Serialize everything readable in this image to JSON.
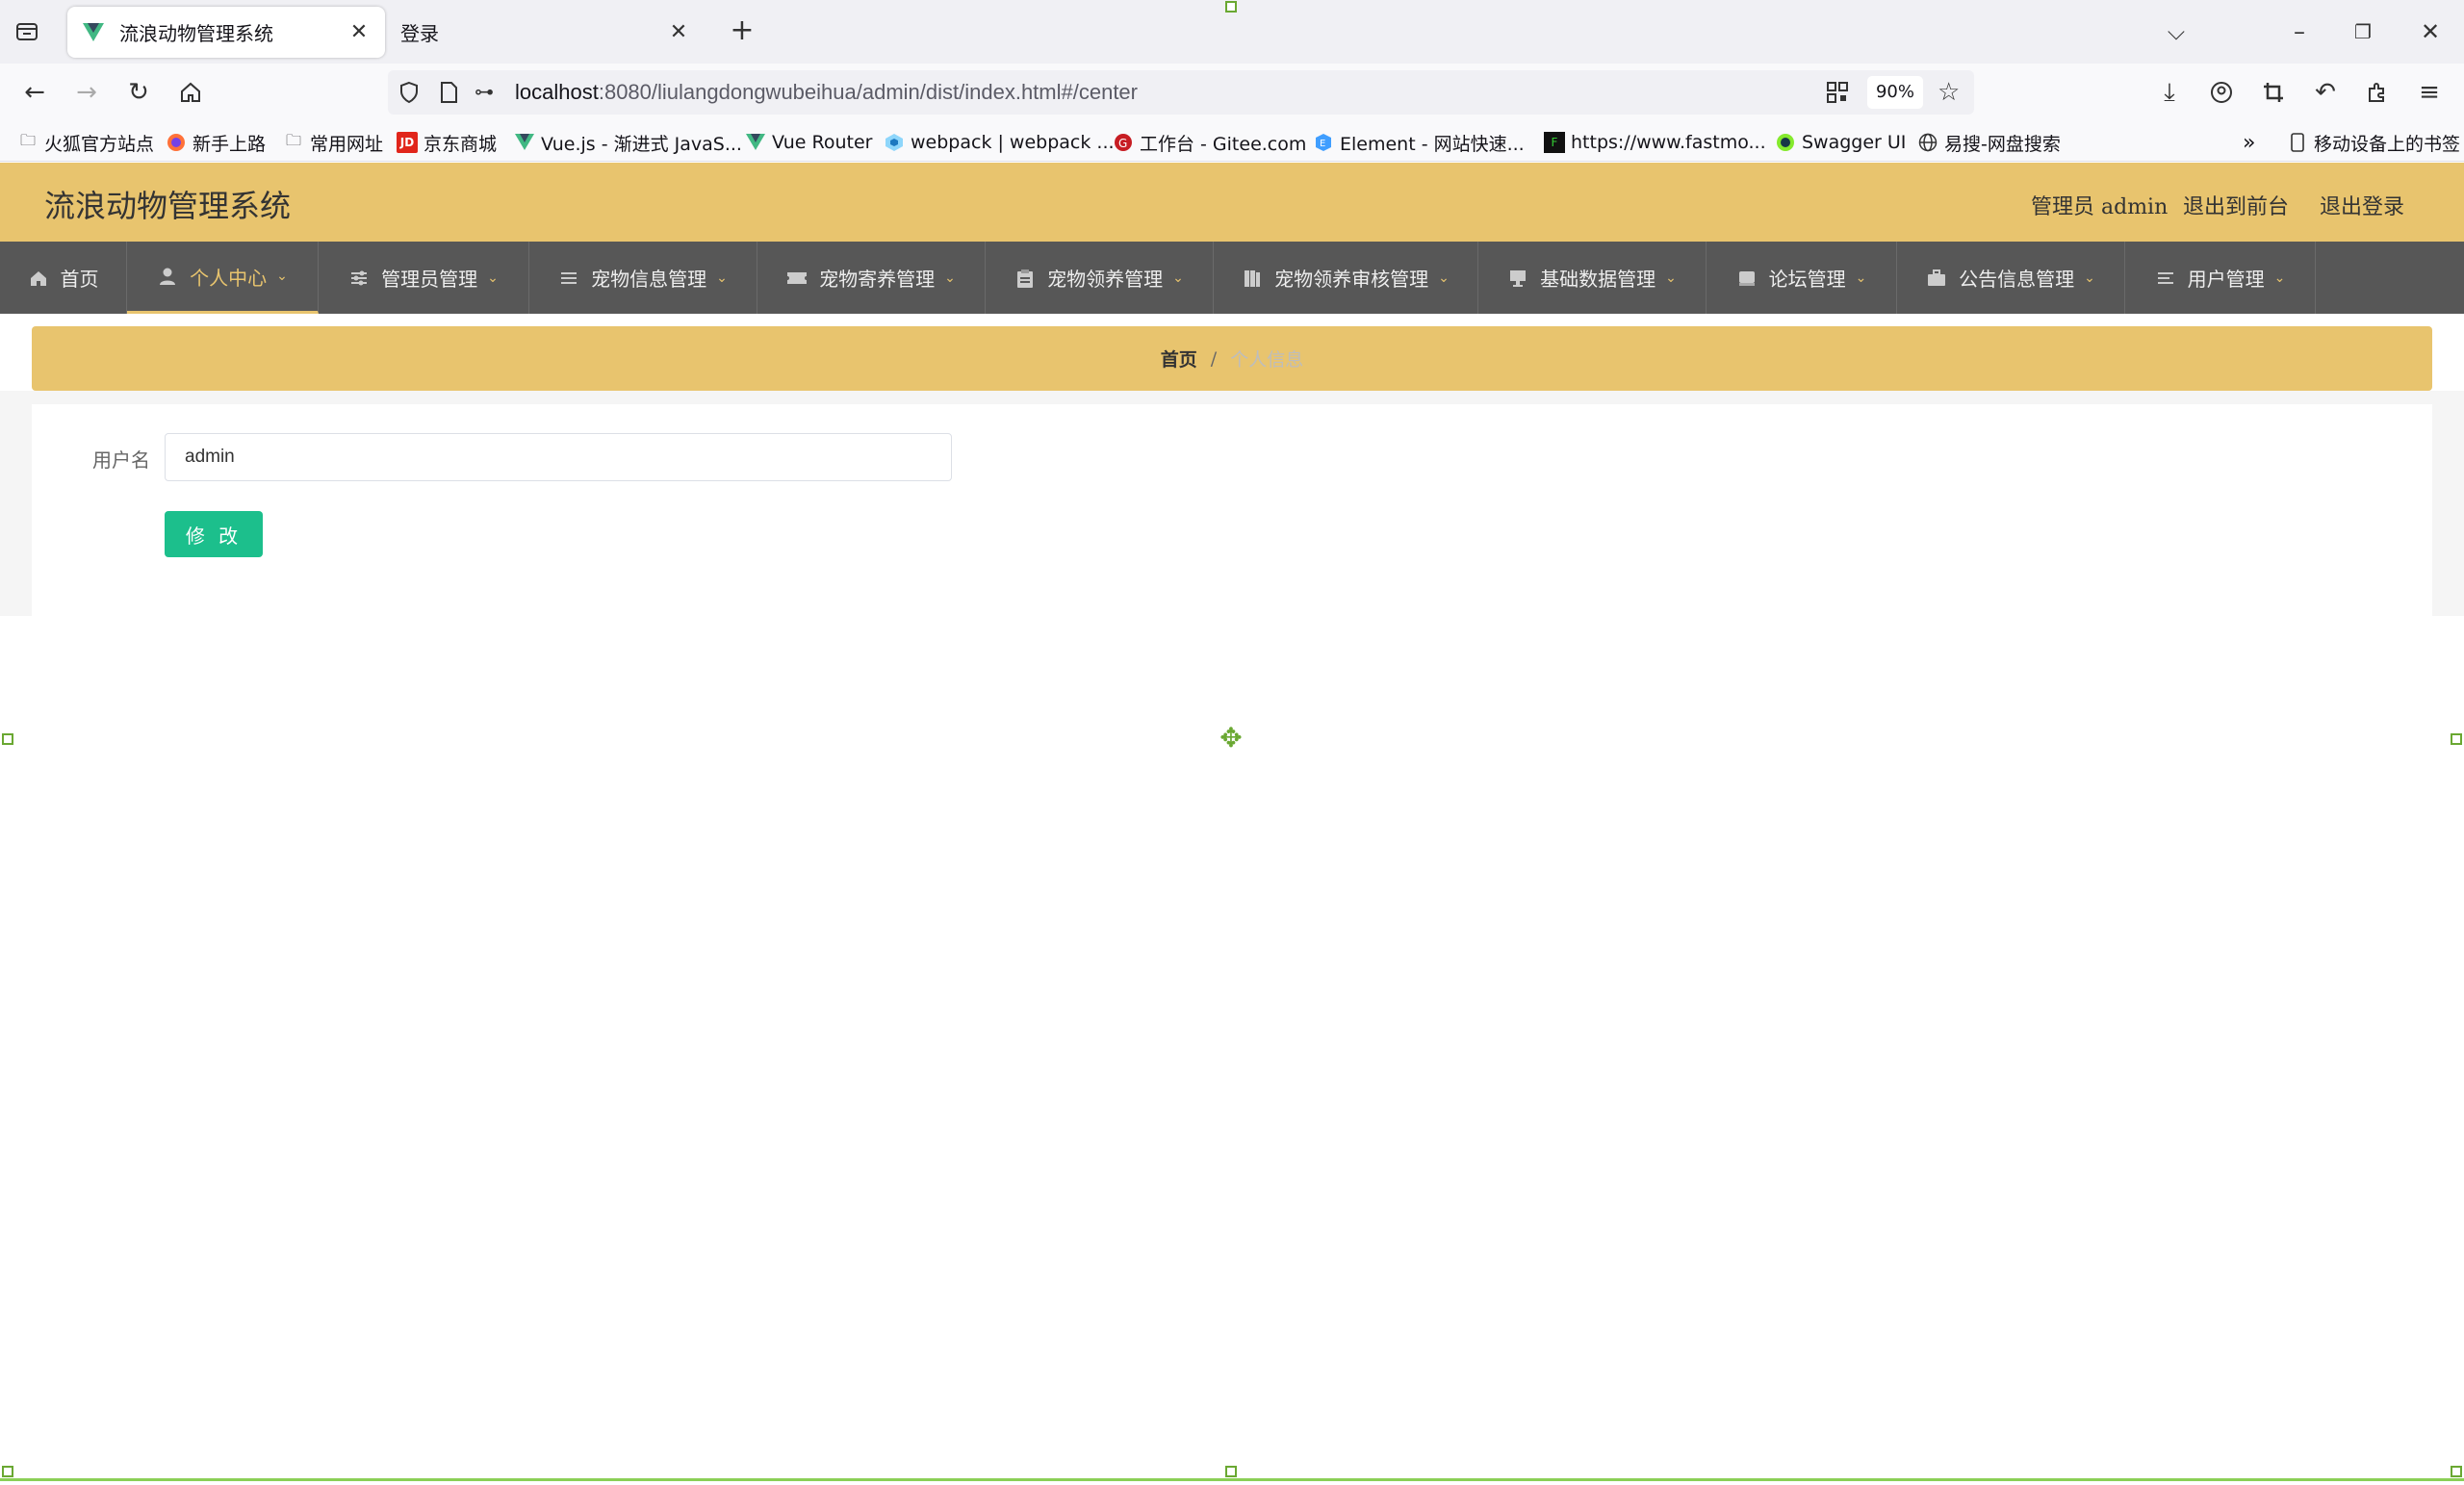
{
  "browser": {
    "tabs": [
      {
        "title": "流浪动物管理系统",
        "active": true
      },
      {
        "title": "登录",
        "active": false
      }
    ],
    "url": {
      "host": "localhost",
      "rest": ":8080/liulangdongwubeihua/admin/dist/index.html#/center"
    },
    "zoom": "90%",
    "bookmarks": [
      {
        "label": "火狐官方站点",
        "icon": "folder-icon"
      },
      {
        "label": "新手上路",
        "icon": "firefox-icon"
      },
      {
        "label": "常用网址",
        "icon": "folder-icon"
      },
      {
        "label": "京东商城",
        "icon": "jd-icon"
      },
      {
        "label": "Vue.js - 渐进式 JavaS...",
        "icon": "vue-icon"
      },
      {
        "label": "Vue Router",
        "icon": "vue-icon"
      },
      {
        "label": "webpack | webpack ...",
        "icon": "webpack-icon"
      },
      {
        "label": "工作台 - Gitee.com",
        "icon": "gitee-icon"
      },
      {
        "label": "Element - 网站快速...",
        "icon": "element-icon"
      },
      {
        "label": "https://www.fastmo...",
        "icon": "fastmock-icon"
      },
      {
        "label": "Swagger UI",
        "icon": "swagger-icon"
      },
      {
        "label": "易搜-网盘搜索",
        "icon": "globe-icon"
      }
    ],
    "mobile_bookmarks": "移动设备上的书签"
  },
  "app": {
    "title": "流浪动物管理系统",
    "header_links": {
      "user": "管理员 admin",
      "to_front": "退出到前台",
      "logout": "退出登录"
    },
    "menu": [
      {
        "label": "首页",
        "icon": "home-icon",
        "dropdown": false
      },
      {
        "label": "个人中心",
        "icon": "user-icon",
        "dropdown": true,
        "active": true
      },
      {
        "label": "管理员管理",
        "icon": "sliders-icon",
        "dropdown": true
      },
      {
        "label": "宠物信息管理",
        "icon": "list-icon",
        "dropdown": true
      },
      {
        "label": "宠物寄养管理",
        "icon": "ticket-icon",
        "dropdown": true
      },
      {
        "label": "宠物领养管理",
        "icon": "clipboard-icon",
        "dropdown": true
      },
      {
        "label": "宠物领养审核管理",
        "icon": "book-icon",
        "dropdown": true
      },
      {
        "label": "基础数据管理",
        "icon": "monitor-icon",
        "dropdown": true
      },
      {
        "label": "论坛管理",
        "icon": "inbox-icon",
        "dropdown": true
      },
      {
        "label": "公告信息管理",
        "icon": "briefcase-icon",
        "dropdown": true
      },
      {
        "label": "用户管理",
        "icon": "menu-icon",
        "dropdown": true
      }
    ],
    "breadcrumb": {
      "home": "首页",
      "separator": "/",
      "current": "个人信息"
    },
    "form": {
      "username_label": "用户名",
      "username_value": "admin",
      "submit_label": "修 改"
    },
    "colors": {
      "accent": "#e8c46e",
      "menu_bg": "#575757",
      "button": "#1cbf8c"
    }
  }
}
